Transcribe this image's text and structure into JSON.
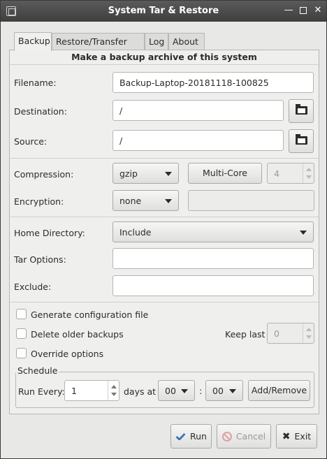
{
  "window": {
    "title": "System Tar & Restore",
    "min_glyph": "—",
    "close_glyph": "✕"
  },
  "tabs": [
    "Backup",
    "Restore/Transfer",
    "Log",
    "About"
  ],
  "active_tab": "Backup",
  "backup": {
    "heading": "Make a backup archive of this system",
    "filename_label": "Filename:",
    "filename_value": "Backup-Laptop-20181118-100825",
    "destination_label": "Destination:",
    "destination_value": "/",
    "source_label": "Source:",
    "source_value": "/",
    "compression_label": "Compression:",
    "compression_value": "gzip",
    "multicore_label": "Multi-Core",
    "threads_value": "4",
    "encryption_label": "Encryption:",
    "encryption_value": "none",
    "passphrase_value": "",
    "home_label": "Home Directory:",
    "home_value": "Include",
    "tar_options_label": "Tar Options:",
    "tar_options_value": "",
    "exclude_label": "Exclude:",
    "exclude_value": "",
    "gen_config_label": "Generate configuration file",
    "gen_config_checked": false,
    "delete_older_label": "Delete older backups",
    "delete_older_checked": false,
    "keep_last_label": "Keep last",
    "keep_last_value": "0",
    "override_label": "Override options",
    "override_checked": false,
    "schedule": {
      "title": "Schedule",
      "run_every_label": "Run Every:",
      "run_every_value": "1",
      "days_at_label": "days at",
      "hour_value": "00",
      "colon": ":",
      "minute_value": "00",
      "add_remove_label": "Add/Remove"
    }
  },
  "footer": {
    "run_label": "Run",
    "cancel_label": "Cancel",
    "exit_label": "Exit"
  },
  "colors": {
    "titlebar": "#3f3f3f",
    "panel_bg": "#efefee",
    "window_bg": "#e8e8e7",
    "check_icon": "#3b6fb5",
    "cancel_icon": "#e1a0a0"
  }
}
